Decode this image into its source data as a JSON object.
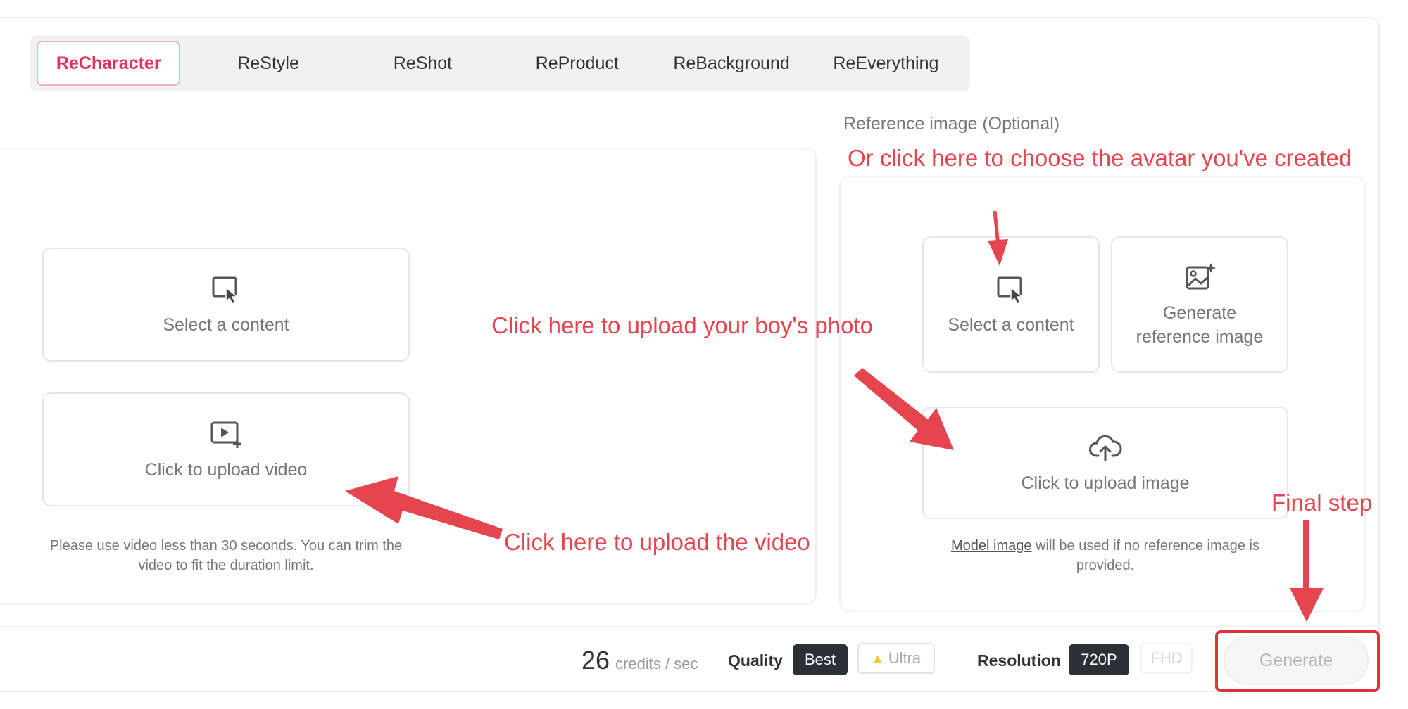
{
  "tabs": [
    {
      "label": "ReCharacter",
      "active": true
    },
    {
      "label": "ReStyle",
      "active": false
    },
    {
      "label": "ReShot",
      "active": false
    },
    {
      "label": "ReProduct",
      "active": false
    },
    {
      "label": "ReBackground",
      "active": false
    },
    {
      "label": "ReEverything",
      "active": false
    }
  ],
  "left": {
    "select_content_label": "Select a content",
    "upload_video_label": "Click to upload video",
    "hint": "Please use video less than 30 seconds. You can trim the video to fit the duration limit."
  },
  "right": {
    "reference_label": "Reference image (Optional)",
    "select_content_label": "Select a content",
    "generate_ref_label": "Generate reference image",
    "upload_image_label": "Click to upload image",
    "hint_link": "Model image",
    "hint_rest": " will be used if no reference image is provided."
  },
  "annotations": {
    "avatar": "Or click here to choose the avatar you've created",
    "photo": "Click here to upload your boy's photo",
    "video": "Click here to upload the video",
    "final": "Final step"
  },
  "bottom": {
    "credits": "26",
    "credits_unit": "credits / sec",
    "quality_label": "Quality",
    "quality_options": [
      "Best",
      "Ultra"
    ],
    "quality_selected": "Best",
    "resolution_label": "Resolution",
    "resolution_options": [
      "720P",
      "FHD"
    ],
    "resolution_selected": "720P",
    "generate_label": "Generate"
  },
  "colors": {
    "accent": "#e5325a",
    "annotation": "#e4454f",
    "dark_pill": "#2b2f36"
  },
  "icons": [
    "select-content-icon",
    "upload-video-icon",
    "generate-image-icon",
    "upload-cloud-icon",
    "bolt-icon"
  ]
}
